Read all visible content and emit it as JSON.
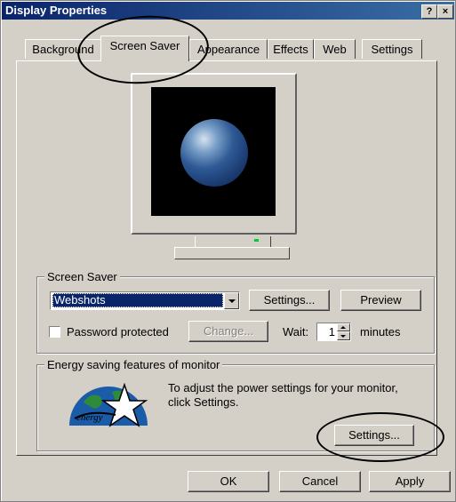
{
  "window": {
    "title": "Display Properties",
    "help_btn": "?",
    "close_btn": "×"
  },
  "tabs": [
    {
      "label": "Background"
    },
    {
      "label": "Screen Saver"
    },
    {
      "label": "Appearance"
    },
    {
      "label": "Effects"
    },
    {
      "label": "Web"
    },
    {
      "label": "Settings"
    }
  ],
  "screensaver": {
    "group_label": "Screen Saver",
    "selected": "Webshots",
    "settings_btn": "Settings...",
    "preview_btn": "Preview",
    "password_label": "Password protected",
    "change_btn": "Change...",
    "wait_label": "Wait:",
    "wait_value": "1",
    "minutes_label": "minutes"
  },
  "energy": {
    "group_label": "Energy saving features of monitor",
    "description": "To adjust the power settings for your monitor, click Settings.",
    "settings_btn": "Settings...",
    "logo_text": "energy"
  },
  "footer": {
    "ok": "OK",
    "cancel": "Cancel",
    "apply": "Apply"
  },
  "colors": {
    "title_bar": "#0a246a",
    "face": "#d4d0c8",
    "selection": "#0a246a"
  }
}
